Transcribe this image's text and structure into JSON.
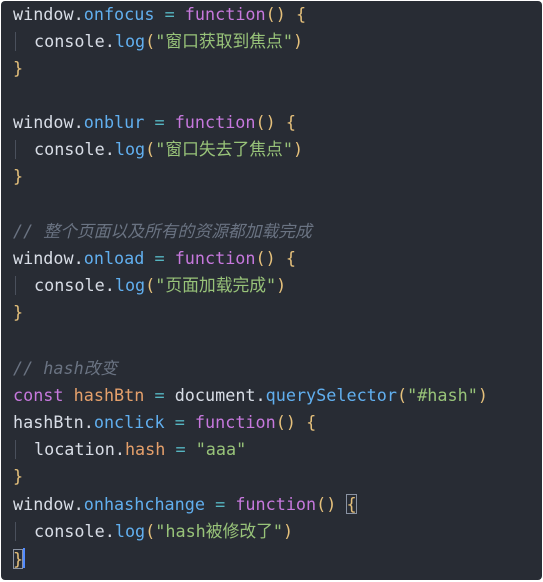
{
  "code": {
    "window": "window",
    "dot": ".",
    "eq": "=",
    "function_kw": "function",
    "parens": "()",
    "open_brace": "{",
    "close_brace": "}",
    "console": "console",
    "log": "log",
    "open_paren": "(",
    "close_paren": ")",
    "onfocus": "onfocus",
    "onblur": "onblur",
    "onload": "onload",
    "onclick": "onclick",
    "onhashchange": "onhashchange",
    "str_focus": "\"窗口获取到焦点\"",
    "str_blur": "\"窗口失去了焦点\"",
    "str_load": "\"页面加载完成\"",
    "str_hash_changed": "\"hash被修改了\"",
    "comment_load": "// 整个页面以及所有的资源都加载完成",
    "comment_hash": "// hash改变",
    "const_kw": "const",
    "hashBtn": "hashBtn",
    "document": "document",
    "querySelector": "querySelector",
    "selector_str": "\"#hash\"",
    "location": "location",
    "hash": "hash",
    "aaa_str": "\"aaa\""
  },
  "colors": {
    "background": "#282c34",
    "keyword": "#c678dd",
    "property": "#61afef",
    "operator": "#56b6c2",
    "brace": "#e5c07b",
    "string": "#98c379",
    "comment": "#6a7382",
    "variable": "#e5a06b",
    "text": "#d8dde6",
    "caret": "#528bff"
  }
}
